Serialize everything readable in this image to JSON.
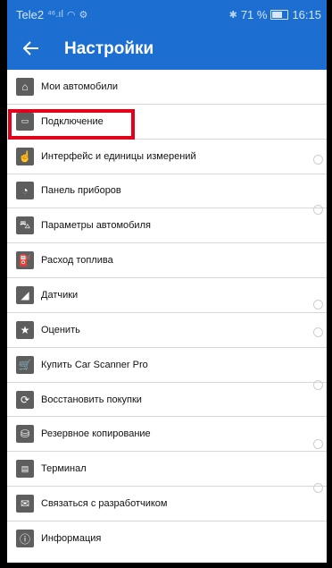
{
  "status": {
    "carrier": "Tele2",
    "signal_icons": "⁴⁶.ıl",
    "battery": "71 %",
    "battery_level": 0.71,
    "time": "16:15"
  },
  "appbar": {
    "back_icon": "arrow-left",
    "title": "Настройки"
  },
  "menu": [
    {
      "label": "Мои автомобили",
      "icon": "garage-icon"
    },
    {
      "label": "Подключение",
      "icon": "connector-icon"
    },
    {
      "label": "Интерфейс и единицы измерений",
      "icon": "hand-icon"
    },
    {
      "label": "Панель приборов",
      "icon": "gauge-icon"
    },
    {
      "label": "Параметры автомобиля",
      "icon": "car-icon"
    },
    {
      "label": "Расход топлива",
      "icon": "fuel-pump-icon"
    },
    {
      "label": "Датчики",
      "icon": "sensor-icon"
    },
    {
      "label": "Оценить",
      "icon": "star-icon"
    },
    {
      "label": "Купить Car Scanner Pro",
      "icon": "cart-icon"
    },
    {
      "label": "Восстановить покупки",
      "icon": "cart-restore-icon"
    },
    {
      "label": "Резервное копирование",
      "icon": "database-icon"
    },
    {
      "label": "Терминал",
      "icon": "terminal-icon"
    },
    {
      "label": "Связаться с разработчиком",
      "icon": "mail-icon"
    },
    {
      "label": "Информация",
      "icon": "info-icon"
    }
  ]
}
